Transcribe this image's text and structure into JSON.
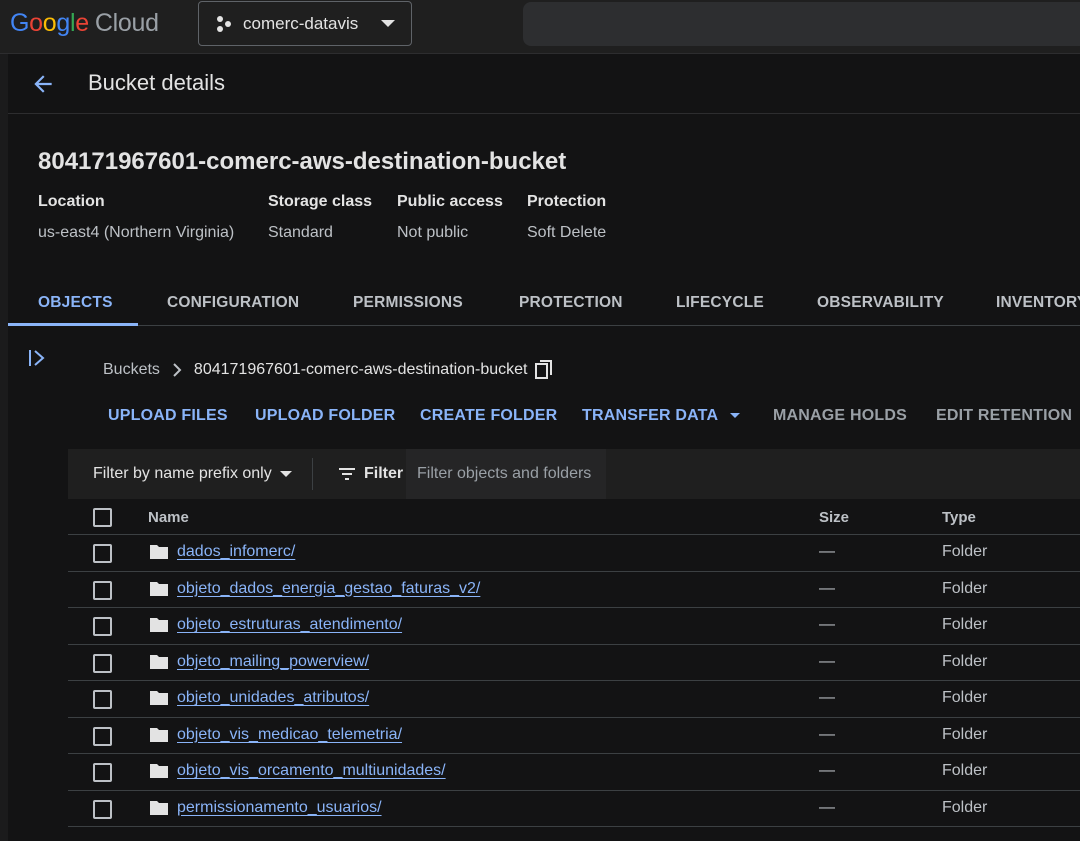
{
  "topbar": {
    "logo": {
      "google": "Google",
      "cloud": "Cloud"
    },
    "project": "comerc-datavis"
  },
  "header": {
    "title": "Bucket details"
  },
  "bucket": {
    "name": "804171967601-comerc-aws-destination-bucket",
    "meta": [
      {
        "label": "Location",
        "value": "us-east4 (Northern Virginia)"
      },
      {
        "label": "Storage class",
        "value": "Standard"
      },
      {
        "label": "Public access",
        "value": "Not public"
      },
      {
        "label": "Protection",
        "value": "Soft Delete"
      }
    ]
  },
  "tabs": [
    "OBJECTS",
    "CONFIGURATION",
    "PERMISSIONS",
    "PROTECTION",
    "LIFECYCLE",
    "OBSERVABILITY",
    "INVENTORY"
  ],
  "breadcrumb": {
    "root": "Buckets",
    "current": "804171967601-comerc-aws-destination-bucket"
  },
  "actions": {
    "upload_files": "UPLOAD FILES",
    "upload_folder": "UPLOAD FOLDER",
    "create_folder": "CREATE FOLDER",
    "transfer_data": "TRANSFER DATA",
    "manage_holds": "MANAGE HOLDS",
    "edit_retention": "EDIT RETENTION"
  },
  "filter": {
    "mode": "Filter by name prefix only",
    "label": "Filter",
    "placeholder": "Filter objects and folders"
  },
  "table": {
    "columns": {
      "name": "Name",
      "size": "Size",
      "type": "Type"
    },
    "rows": [
      {
        "name": "dados_infomerc/",
        "size": "—",
        "type": "Folder"
      },
      {
        "name": "objeto_dados_energia_gestao_faturas_v2/",
        "size": "—",
        "type": "Folder"
      },
      {
        "name": "objeto_estruturas_atendimento/",
        "size": "—",
        "type": "Folder"
      },
      {
        "name": "objeto_mailing_powerview/",
        "size": "—",
        "type": "Folder"
      },
      {
        "name": "objeto_unidades_atributos/",
        "size": "—",
        "type": "Folder"
      },
      {
        "name": "objeto_vis_medicao_telemetria/",
        "size": "—",
        "type": "Folder"
      },
      {
        "name": "objeto_vis_orcamento_multiunidades/",
        "size": "—",
        "type": "Folder"
      },
      {
        "name": "permissionamento_usuarios/",
        "size": "—",
        "type": "Folder"
      }
    ]
  },
  "colors": {
    "accent": "#8ab4f8",
    "background": "#131314"
  }
}
